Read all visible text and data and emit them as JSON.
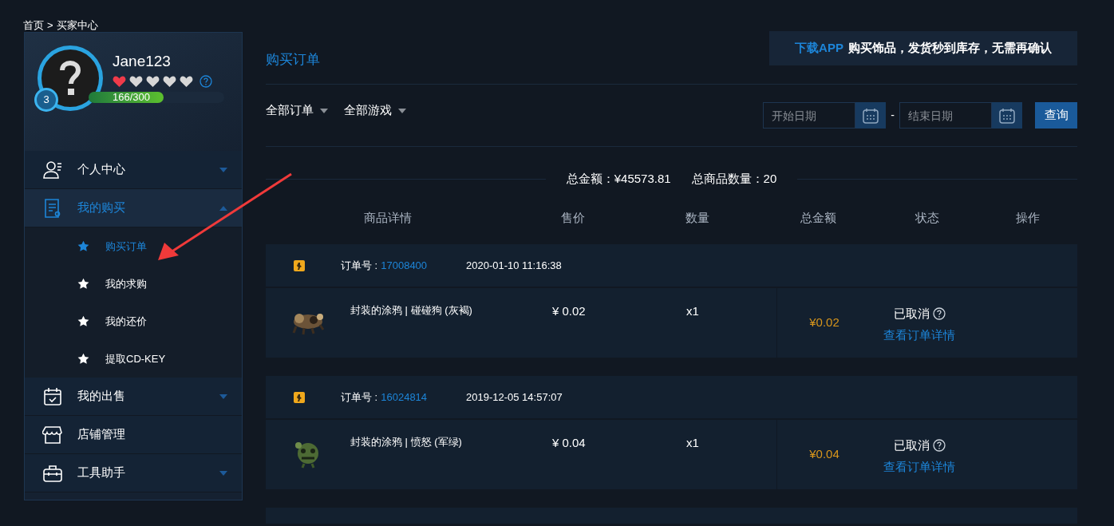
{
  "breadcrumb": {
    "items": [
      "首页",
      "买家中心"
    ],
    "separator": ">"
  },
  "profile": {
    "username": "Jane123",
    "level_badge": "3",
    "stars": 1,
    "exp": {
      "reading": "166/300",
      "level": 0.553
    }
  },
  "sidebar": {
    "items": [
      {
        "label": "个人中心",
        "kind": "group",
        "expanded": false,
        "selected": false
      },
      {
        "label": "我的购买",
        "kind": "group",
        "expanded": true,
        "selected": true,
        "children": [
          {
            "label": "购买订单",
            "selected": true
          },
          {
            "label": "我的求购",
            "selected": false
          },
          {
            "label": "我的还价",
            "selected": false
          },
          {
            "label": "提取CD-KEY",
            "selected": false
          }
        ]
      },
      {
        "label": "我的出售",
        "kind": "group",
        "expanded": false,
        "selected": false
      },
      {
        "label": "店铺管理",
        "kind": "link",
        "selected": false
      },
      {
        "label": "工具助手",
        "kind": "group",
        "expanded": false,
        "selected": false
      }
    ]
  },
  "main": {
    "title": "购买订单",
    "banner": {
      "highlight": "下载APP",
      "text": "购买饰品，发货**秒到**库存，无需再确认"
    },
    "filters": [
      {
        "label": "全部订单"
      },
      {
        "label": "全部游戏"
      }
    ],
    "date_range": {
      "start_placeholder": "开始日期",
      "separator": "-",
      "end_placeholder": "结束日期"
    },
    "query_button": "查询",
    "summary": [
      "总金额：¥45573.81",
      "总商品数量：20"
    ],
    "columns": [
      "商品详情",
      "售价",
      "数量",
      "总金额",
      "状态",
      "操作"
    ],
    "orders": [
      {
        "number_label": "订单号 :",
        "number": "17008400",
        "time": "2020-01-10 11:16:38",
        "item": {
          "name": "封装的涂鸦 | 碰碰狗 (灰褐)",
          "price": "¥ 0.02",
          "quantity": "x1"
        },
        "total": "¥0.02",
        "status": "已取消",
        "action": "查看订单详情"
      },
      {
        "number_label": "订单号 :",
        "number": "16024814",
        "time": "2019-12-05 14:57:07",
        "item": {
          "name": "封装的涂鸦 | 愤怒 (军绿)",
          "price": "¥ 0.04",
          "quantity": "x1"
        },
        "total": "¥0.04",
        "status": "已取消",
        "action": "查看订单详情"
      }
    ]
  }
}
